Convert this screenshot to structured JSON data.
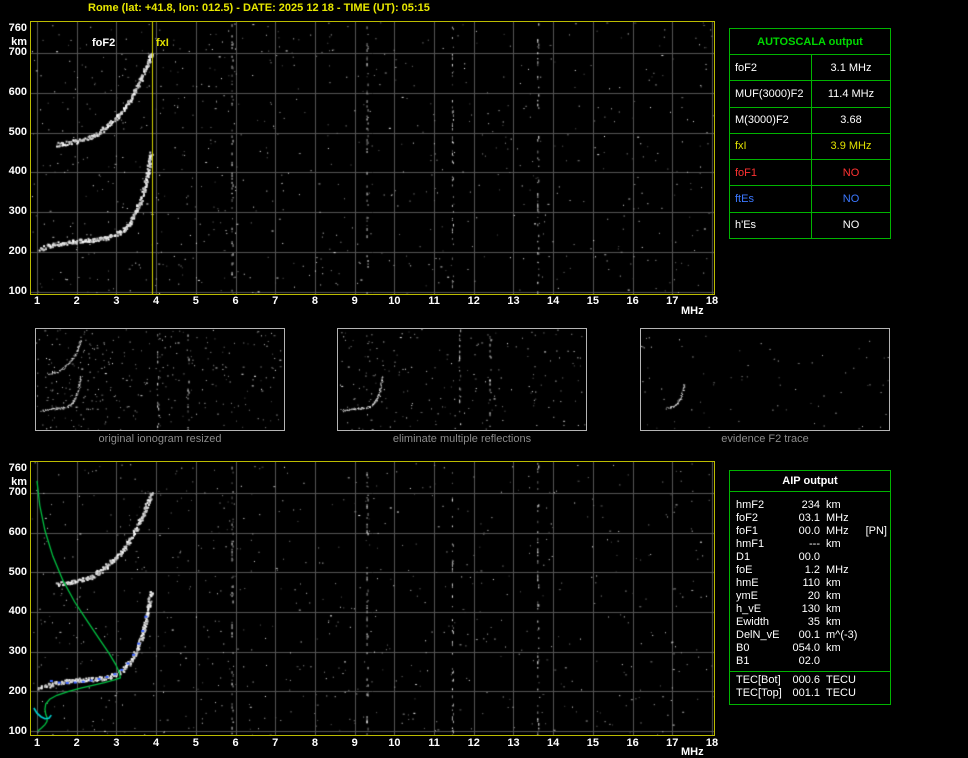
{
  "title": "Rome (lat: +41.8, lon: 012.5) - DATE: 2025 12 18 - TIME (UT): 05:15",
  "annotations": {
    "foF2_marker": "foF2",
    "fxI_marker": "fxI"
  },
  "axes": {
    "x_label": "MHz",
    "y_label": "km",
    "x_ticks": [
      1,
      2,
      3,
      4,
      5,
      6,
      7,
      8,
      9,
      10,
      11,
      12,
      13,
      14,
      15,
      16,
      17,
      18
    ],
    "y_ticks": [
      760,
      700,
      600,
      500,
      400,
      300,
      200,
      100
    ],
    "x_range": [
      1,
      18
    ],
    "y_range": [
      100,
      760
    ]
  },
  "autoscala_table": {
    "title": "AUTOSCALA output",
    "rows": [
      {
        "label": "foF2",
        "value": "3.1 MHz",
        "color": "#ffffff"
      },
      {
        "label": "MUF(3000)F2",
        "value": "11.4 MHz",
        "color": "#ffffff"
      },
      {
        "label": "M(3000)F2",
        "value": "3.68",
        "color": "#ffffff"
      },
      {
        "label": "fxI",
        "value": "3.9 MHz",
        "color": "#e0e000"
      },
      {
        "label": "foF1",
        "value": "NO",
        "color": "#ff3232"
      },
      {
        "label": "ftEs",
        "value": "NO",
        "color": "#3c78ff"
      },
      {
        "label": "h'Es",
        "value": "NO",
        "color": "#ffffff"
      }
    ]
  },
  "aip_table": {
    "title": "AIP output",
    "rows": [
      {
        "name": "hmF2",
        "value": "234",
        "unit": "km",
        "note": ""
      },
      {
        "name": "foF2",
        "value": "03.1",
        "unit": "MHz",
        "note": ""
      },
      {
        "name": "foF1",
        "value": "00.0",
        "unit": "MHz",
        "note": "[PN]"
      },
      {
        "name": "hmF1",
        "value": "---",
        "unit": "km",
        "note": ""
      },
      {
        "name": "D1",
        "value": "00.0",
        "unit": "",
        "note": ""
      },
      {
        "name": "foE",
        "value": "1.2",
        "unit": "MHz",
        "note": ""
      },
      {
        "name": "hmE",
        "value": "110",
        "unit": "km",
        "note": ""
      },
      {
        "name": "ymE",
        "value": "20",
        "unit": "km",
        "note": ""
      },
      {
        "name": "h_vE",
        "value": "130",
        "unit": "km",
        "note": ""
      },
      {
        "name": "Ewidth",
        "value": "35",
        "unit": "km",
        "note": ""
      },
      {
        "name": "DelN_vE",
        "value": "00.1",
        "unit": "m^(-3)",
        "note": ""
      },
      {
        "name": "B0",
        "value": "054.0",
        "unit": "km",
        "note": ""
      },
      {
        "name": "B1",
        "value": "02.0",
        "unit": "",
        "note": ""
      }
    ],
    "tec_rows": [
      {
        "name": "TEC[Bot]",
        "value": "000.6",
        "unit": "TECU"
      },
      {
        "name": "TEC[Top]",
        "value": "001.1",
        "unit": "TECU"
      }
    ]
  },
  "thumbnails": [
    {
      "caption": "original ionogram resized"
    },
    {
      "caption": "eliminate multiple reflections"
    },
    {
      "caption": "evidence F2 trace"
    }
  ],
  "chart_data": {
    "type": "scatter",
    "xlabel": "MHz",
    "ylabel": "km",
    "xlim": [
      1,
      18
    ],
    "ylim": [
      100,
      760
    ],
    "readings": {
      "foF2_MHz": 3.1,
      "MUF3000F2_MHz": 11.4,
      "M3000F2": 3.68,
      "fxI_MHz": 3.9,
      "hmF2_km": 234,
      "TEC_bot_TECU": 0.6,
      "TEC_top_TECU": 1.1
    },
    "traces": {
      "f2": [
        [
          1.05,
          210
        ],
        [
          1.3,
          218
        ],
        [
          1.6,
          224
        ],
        [
          1.9,
          228
        ],
        [
          2.2,
          231
        ],
        [
          2.5,
          233
        ],
        [
          2.75,
          237
        ],
        [
          2.95,
          244
        ],
        [
          3.15,
          256
        ],
        [
          3.3,
          272
        ],
        [
          3.45,
          296
        ],
        [
          3.58,
          326
        ],
        [
          3.68,
          358
        ],
        [
          3.76,
          396
        ],
        [
          3.82,
          428
        ],
        [
          3.86,
          452
        ]
      ],
      "f2_evidence": [
        [
          2.5,
          233
        ],
        [
          2.75,
          237
        ],
        [
          2.95,
          244
        ],
        [
          3.15,
          256
        ],
        [
          3.3,
          272
        ],
        [
          3.45,
          296
        ],
        [
          3.58,
          326
        ],
        [
          3.68,
          358
        ],
        [
          3.76,
          396
        ]
      ],
      "second_hop": [
        [
          1.5,
          472
        ],
        [
          1.8,
          477
        ],
        [
          2.1,
          482
        ],
        [
          2.35,
          490
        ],
        [
          2.6,
          505
        ],
        [
          2.85,
          527
        ],
        [
          3.1,
          550
        ],
        [
          3.3,
          578
        ],
        [
          3.45,
          605
        ],
        [
          3.6,
          635
        ],
        [
          3.7,
          660
        ],
        [
          3.8,
          682
        ],
        [
          3.86,
          702
        ]
      ],
      "profile_green": [
        [
          1.02,
          100
        ],
        [
          1.12,
          108
        ],
        [
          1.2,
          116
        ],
        [
          1.25,
          124
        ],
        [
          1.26,
          132
        ],
        [
          1.22,
          142
        ],
        [
          1.2,
          155
        ],
        [
          1.22,
          168
        ],
        [
          1.32,
          180
        ],
        [
          1.5,
          190
        ],
        [
          1.8,
          200
        ],
        [
          2.1,
          208
        ],
        [
          2.4,
          215
        ],
        [
          2.7,
          222
        ],
        [
          2.95,
          229
        ],
        [
          3.08,
          233
        ],
        [
          3.1,
          234
        ],
        [
          3.07,
          248
        ],
        [
          2.98,
          268
        ],
        [
          2.82,
          295
        ],
        [
          2.58,
          330
        ],
        [
          2.28,
          375
        ],
        [
          1.95,
          425
        ],
        [
          1.65,
          480
        ],
        [
          1.4,
          540
        ],
        [
          1.2,
          605
        ],
        [
          1.07,
          668
        ],
        [
          1.0,
          730
        ]
      ],
      "fitted_blue": [
        [
          1.35,
          226
        ],
        [
          1.55,
          222
        ],
        [
          1.75,
          221
        ],
        [
          1.95,
          222
        ],
        [
          2.15,
          224
        ],
        [
          2.35,
          227
        ],
        [
          2.55,
          231
        ],
        [
          2.75,
          236
        ],
        [
          2.95,
          243
        ],
        [
          3.12,
          254
        ],
        [
          3.28,
          270
        ],
        [
          3.42,
          292
        ],
        [
          3.55,
          320
        ],
        [
          3.65,
          352
        ],
        [
          3.73,
          388
        ]
      ],
      "e_region_cyan": [
        [
          0.92,
          158
        ],
        [
          1.0,
          145
        ],
        [
          1.1,
          136
        ],
        [
          1.2,
          131
        ],
        [
          1.3,
          132
        ],
        [
          1.36,
          140
        ]
      ]
    },
    "panels": {
      "top": {
        "traces": [
          "f2",
          "second_hop"
        ],
        "noise": 620,
        "stripes": [
          5.9,
          9.3,
          11.45,
          13.6
        ],
        "vline": 3.9
      },
      "bottom": {
        "traces": [
          "f2",
          "second_hop"
        ],
        "curves": [
          "profile_green"
        ],
        "cyan": [
          "e_region_cyan"
        ],
        "markers": [
          "fitted_blue"
        ],
        "noise": 560,
        "stripes": [
          5.9,
          9.3,
          11.45,
          13.6
        ]
      },
      "thumb1": {
        "traces": [
          "f2",
          "second_hop"
        ],
        "noise": 260,
        "stripes": [
          9.3,
          11.45
        ]
      },
      "thumb2": {
        "traces": [
          "f2"
        ],
        "noise": 170,
        "stripes": [
          9.3,
          11.45
        ]
      },
      "thumb3": {
        "traces": [
          "f2_evidence"
        ],
        "noise": 60,
        "stripes": []
      }
    }
  }
}
